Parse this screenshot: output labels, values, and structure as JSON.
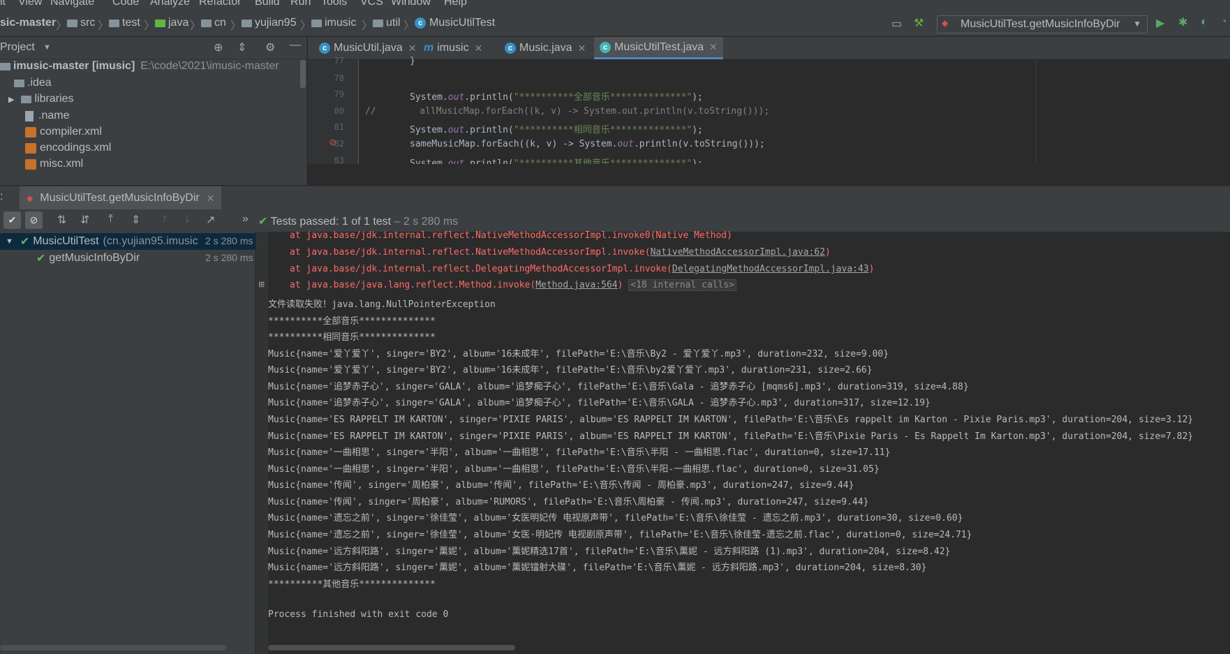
{
  "menu": [
    "it",
    "View",
    "Navigate",
    "Code",
    "Analyze",
    "Refactor",
    "Build",
    "Run",
    "Tools",
    "VCS",
    "Window",
    "Help"
  ],
  "breadcrumb": {
    "project": "sic-master",
    "items": [
      "src",
      "test",
      "java",
      "cn",
      "yujian95",
      "imusic",
      "util",
      "MusicUtilTest"
    ]
  },
  "run_config": "MusicUtilTest.getMusicInfoByDir",
  "project_panel": {
    "title": "Project",
    "root": "imusic-master [imusic]",
    "root_path": "E:\\code\\2021\\imusic-master",
    "items": [
      ".idea",
      "libraries",
      ".name",
      "compiler.xml",
      "encodings.xml",
      "misc.xml"
    ]
  },
  "editor_tabs": [
    {
      "label": "MusicUtil.java",
      "icon": "c"
    },
    {
      "label": "imusic",
      "icon": "m"
    },
    {
      "label": "Music.java",
      "icon": "c"
    },
    {
      "label": "MusicUtilTest.java",
      "icon": "c",
      "active": true
    }
  ],
  "editor": {
    "lines": [
      {
        "n": "77",
        "code": "}"
      },
      {
        "n": "78",
        "code": ""
      },
      {
        "n": "79",
        "code": "System.out.println(\"**********全部音乐**************\");"
      },
      {
        "n": "80",
        "code": "//        allMusicMap.forEach((k, v) -> System.out.println(v.toString()));"
      },
      {
        "n": "81",
        "code": "System.out.println(\"**********相同音乐**************\");"
      },
      {
        "n": "82",
        "code": "sameMusicMap.forEach((k, v) -> System.out.println(v.toString()));"
      },
      {
        "n": "83",
        "code": "System.out.println(\"**********其他音乐**************\");"
      }
    ]
  },
  "run_panel": {
    "label": ":",
    "tab": "MusicUtilTest.getMusicInfoByDir",
    "status": "Tests passed:",
    "status_count": "1 of 1 test",
    "status_time": "– 2 s 280 ms",
    "tree": [
      {
        "name": "MusicUtilTest",
        "detail": "(cn.yujian95.imusic",
        "time": "2 s 280 ms"
      },
      {
        "name": "getMusicInfoByDir",
        "detail": "",
        "time": "2 s 280 ms"
      }
    ]
  },
  "console": {
    "stack": [
      {
        "text": "at java.base/jdk.internal.reflect.NativeMethodAccessorImpl.invoke0(",
        "link": "Native Method",
        "tail": ")"
      },
      {
        "text": "at java.base/jdk.internal.reflect.NativeMethodAccessorImpl.invoke(",
        "link": "NativeMethodAccessorImpl.java:62",
        "tail": ")"
      },
      {
        "text": "at java.base/jdk.internal.reflect.DelegatingMethodAccessorImpl.invoke(",
        "link": "DelegatingMethodAccessorImpl.java:43",
        "tail": ")"
      },
      {
        "text": "at java.base/java.lang.reflect.Method.invoke(",
        "link": "Method.java:564",
        "tail": ") ",
        "fold": "<18 internal calls>"
      }
    ],
    "output": [
      "文件读取失败！java.lang.NullPointerException",
      "**********全部音乐**************",
      "**********相同音乐**************",
      "Music{name='爱丫爱丫', singer='BY2', album='16未成年', filePath='E:\\音乐\\By2 - 爱丫爱丫.mp3', duration=232, size=9.00}",
      "Music{name='爱丫爱丫', singer='BY2', album='16未成年', filePath='E:\\音乐\\by2爱丫爱丫.mp3', duration=231, size=2.66}",
      "Music{name='追梦赤子心', singer='GALA', album='追梦痴子心', filePath='E:\\音乐\\Gala - 追梦赤子心 [mqms6].mp3', duration=319, size=4.88}",
      "Music{name='追梦赤子心', singer='GALA', album='追梦痴子心', filePath='E:\\音乐\\GALA - 追梦赤子心.mp3', duration=317, size=12.19}",
      "Music{name='ES RAPPELT IM KARTON', singer='PIXIE PARIS', album='ES RAPPELT IM KARTON', filePath='E:\\音乐\\Es rappelt im Karton - Pixie Paris.mp3', duration=204, size=3.12}",
      "Music{name='ES RAPPELT IM KARTON', singer='PIXIE PARIS', album='ES RAPPELT IM KARTON', filePath='E:\\音乐\\Pixie Paris - Es Rappelt Im Karton.mp3', duration=204, size=7.82}",
      "Music{name='一曲相思', singer='半阳', album='一曲相思', filePath='E:\\音乐\\半阳 - 一曲相思.flac', duration=0, size=17.11}",
      "Music{name='一曲相思', singer='半阳', album='一曲相思', filePath='E:\\音乐\\半阳-一曲相思.flac', duration=0, size=31.05}",
      "Music{name='传闻', singer='周柏豪', album='传闻', filePath='E:\\音乐\\传闻 - 周柏豪.mp3', duration=247, size=9.44}",
      "Music{name='传闻', singer='周柏豪', album='RUMORS', filePath='E:\\音乐\\周柏豪 - 传闻.mp3', duration=247, size=9.44}",
      "Music{name='遗忘之前', singer='徐佳莹', album='女医明妃传 电视原声带', filePath='E:\\音乐\\徐佳莹 - 遗忘之前.mp3', duration=30, size=0.60}",
      "Music{name='遗忘之前', singer='徐佳莹', album='女医·明妃传 电视剧原声带', filePath='E:\\音乐\\徐佳莹-遗忘之前.flac', duration=0, size=24.71}",
      "Music{name='远方斜阳路', singer='薰妮', album='薰妮精选17首', filePath='E:\\音乐\\薰妮 - 远方斜阳路 (1).mp3', duration=204, size=8.42}",
      "Music{name='远方斜阳路', singer='薰妮', album='薰妮镭射大碟', filePath='E:\\音乐\\薰妮 - 远方斜阳路.mp3', duration=204, size=8.30}",
      "**********其他音乐**************",
      "",
      "Process finished with exit code 0"
    ]
  },
  "colors": {
    "bg": "#2b2b2b",
    "panel": "#3c3f41",
    "accent": "#4a88c7",
    "error": "#ff6b68",
    "success": "#5fb55f"
  }
}
